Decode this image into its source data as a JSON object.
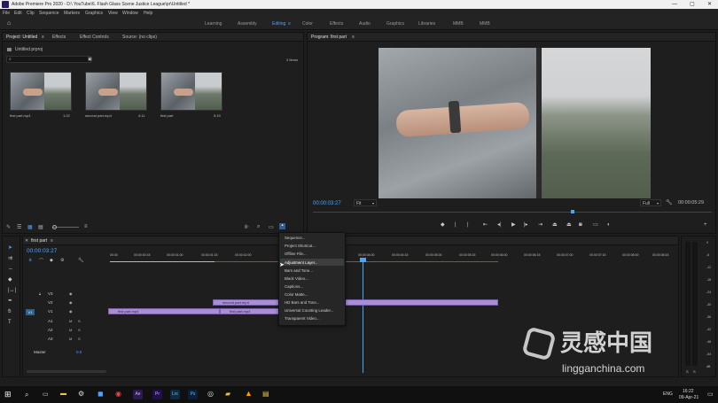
{
  "window": {
    "title": "Adobe Premiere Pro 2020 - D:\\ YouTube\\6. Flash Glass Scene Justice League\\pr\\Untitled *"
  },
  "menu": [
    "File",
    "Edit",
    "Clip",
    "Sequence",
    "Markers",
    "Graphics",
    "View",
    "Window",
    "Help"
  ],
  "workspaces": [
    "Learning",
    "Assembly",
    "Editing",
    "Color",
    "Effects",
    "Audio",
    "Graphics",
    "Libraries",
    "MMB",
    "MMB"
  ],
  "active_workspace": "Editing",
  "project_panel": {
    "tabs": [
      "Project: Untitled",
      "Effects",
      "Effect Controls",
      "Source: (no clips)"
    ],
    "file": "Untitled.prproj",
    "search_placeholder": "",
    "item_count": "3 Items",
    "clips": [
      {
        "name": "first part.mp4",
        "duration": "1:22"
      },
      {
        "name": "second part.mp4",
        "duration": "4:11"
      },
      {
        "name": "first part",
        "duration": "5:19"
      }
    ]
  },
  "program_monitor": {
    "title": "Program: first part",
    "timecode": "00:00:03:27",
    "fit": "Fit",
    "quality": "Full",
    "duration": "00:00:05:29"
  },
  "timeline": {
    "sequence_name": "first part",
    "timecode": "00:00:03:27",
    "ruler": [
      "00:00",
      "00:00:00:15",
      "00:00:01:00",
      "00:00:01:15",
      "00:00:02:00",
      "00:00:04:00",
      "00:00:04:15",
      "00:00:05:00",
      "00:00:05:15",
      "00:00:06:00",
      "00:00:06:15",
      "00:00:07:00",
      "00:00:07:15",
      "00:00:08:00",
      "00:00:08:15"
    ],
    "tracks_video": [
      "V3",
      "V2",
      "V1"
    ],
    "tracks_audio": [
      "A1",
      "A2",
      "A3"
    ],
    "master": "Master",
    "master_value": "0.0",
    "clips": [
      {
        "label": "second part.mp4"
      },
      {
        "label": "first part.mp4"
      },
      {
        "label": "first part.mp4"
      }
    ]
  },
  "new_item_menu": {
    "items": [
      "Sequence...",
      "Project Shortcut...",
      "Offline File...",
      "Adjustment Layer...",
      "Bars and Tone...",
      "Black Video...",
      "Captions...",
      "Color Matte...",
      "HD Bars and Tone...",
      "Universal Counting Leader...",
      "Transparent Video..."
    ],
    "highlighted": "Adjustment Layer..."
  },
  "audio_meter": {
    "scale": [
      "0",
      "-6",
      "-12",
      "-18",
      "-24",
      "-30",
      "-36",
      "-42",
      "-48",
      "-54",
      "dB"
    ],
    "bottom": [
      "S",
      "S"
    ]
  },
  "watermark": {
    "cn": "灵感中国",
    "url": "lingganchina.com"
  },
  "taskbar": {
    "apps": [
      "Ae",
      "Pr",
      "Lrc",
      "Ps"
    ],
    "lang": "ENG",
    "time": "16:22",
    "date": "09-Apr-21"
  }
}
